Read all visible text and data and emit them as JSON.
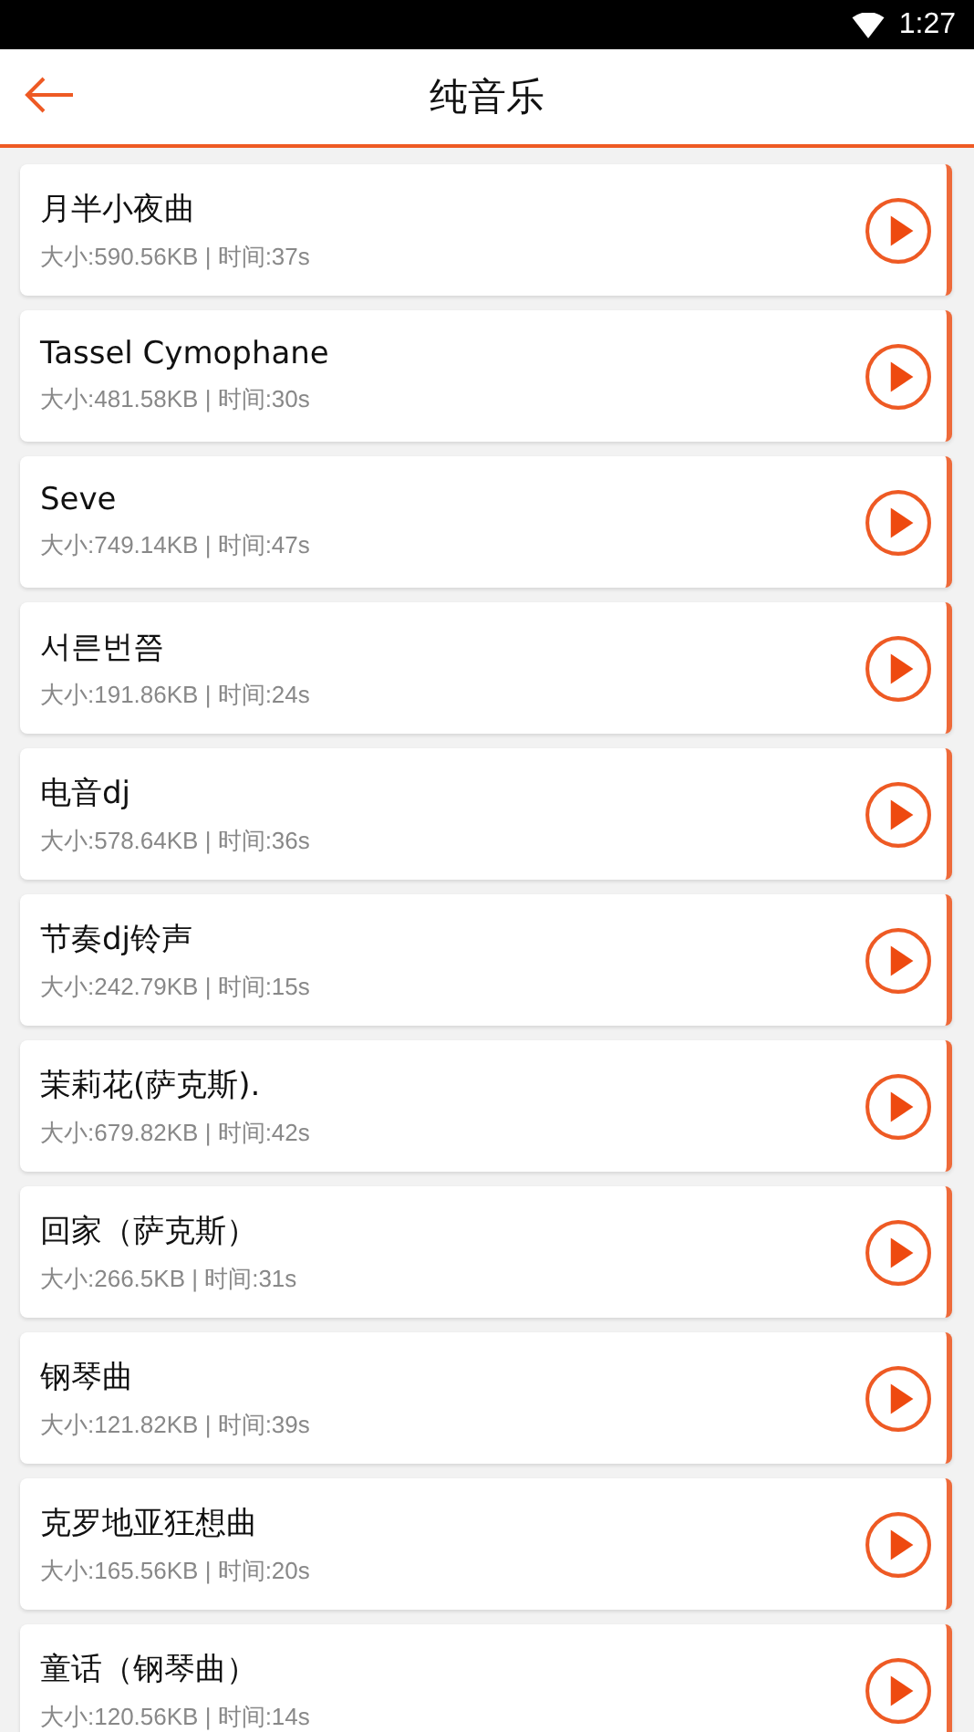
{
  "status_bar": {
    "time": "1:27"
  },
  "header": {
    "title": "纯音乐"
  },
  "tracks": [
    {
      "title": "月半小夜曲",
      "meta": "大小:590.56KB | 时间:37s"
    },
    {
      "title": "Tassel Cymophane",
      "meta": "大小:481.58KB | 时间:30s"
    },
    {
      "title": "Seve",
      "meta": "大小:749.14KB | 时间:47s"
    },
    {
      "title": "서른번쯤",
      "meta": "大小:191.86KB | 时间:24s"
    },
    {
      "title": "电音dj",
      "meta": "大小:578.64KB | 时间:36s"
    },
    {
      "title": "节奏dj铃声",
      "meta": "大小:242.79KB | 时间:15s"
    },
    {
      "title": "茉莉花(萨克斯).",
      "meta": "大小:679.82KB | 时间:42s"
    },
    {
      "title": "回家（萨克斯）",
      "meta": "大小:266.5KB | 时间:31s"
    },
    {
      "title": "钢琴曲",
      "meta": "大小:121.82KB | 时间:39s"
    },
    {
      "title": "克罗地亚狂想曲",
      "meta": "大小:165.56KB | 时间:20s"
    },
    {
      "title": "童话（钢琴曲）",
      "meta": "大小:120.56KB | 时间:14s"
    }
  ]
}
